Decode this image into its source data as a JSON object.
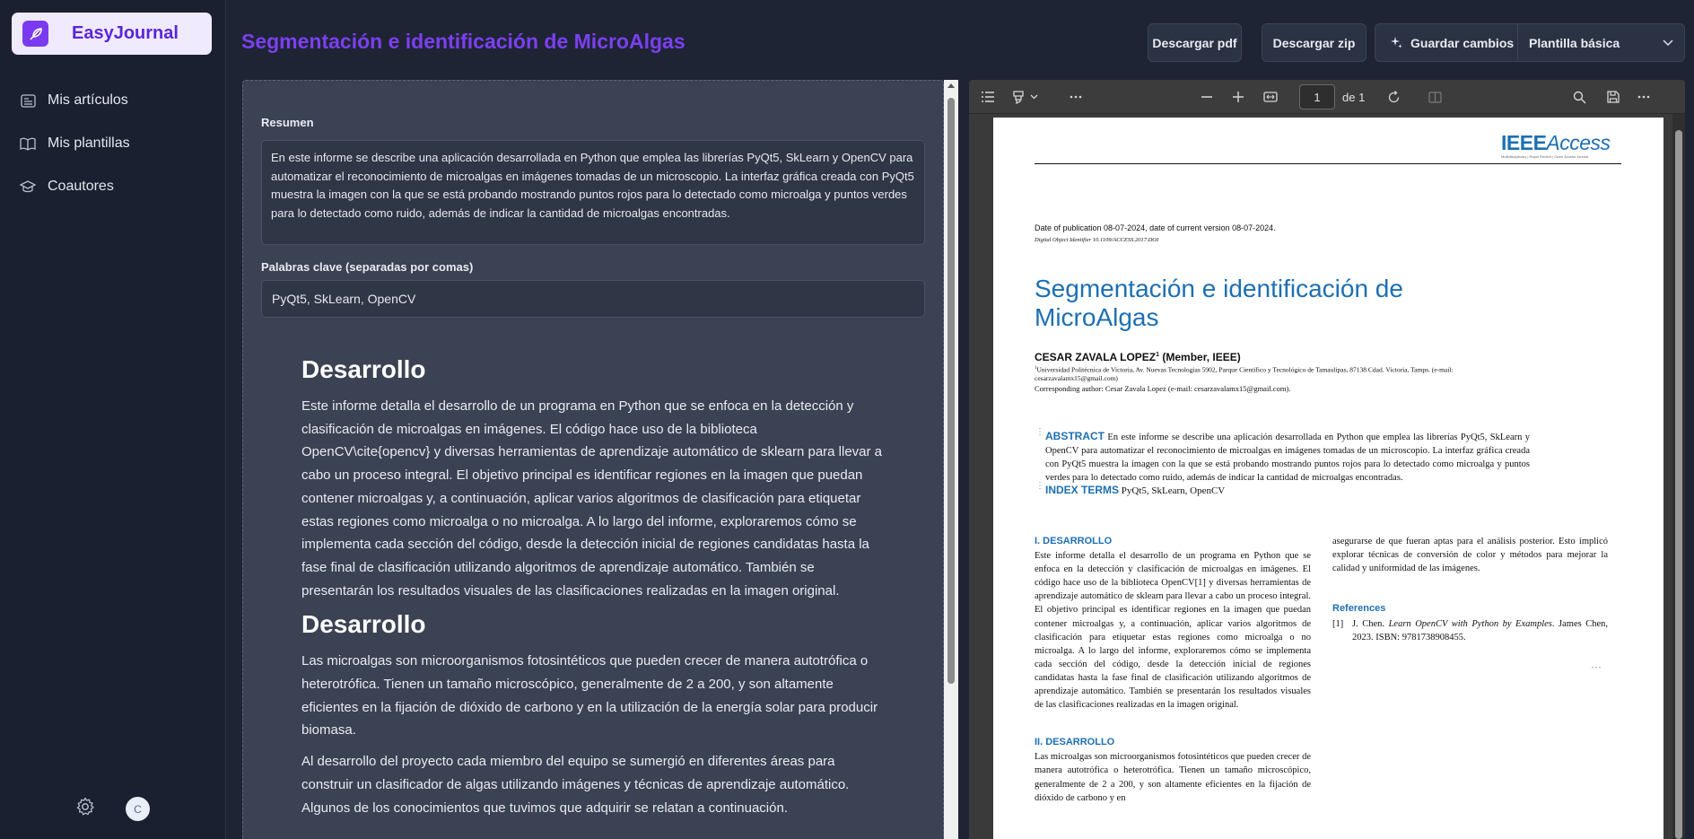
{
  "app": {
    "name": "EasyJournal"
  },
  "nav": [
    {
      "label": "Mis artículos",
      "icon": "articles-icon"
    },
    {
      "label": "Mis plantillas",
      "icon": "book-icon"
    },
    {
      "label": "Coautores",
      "icon": "graduation-cap-icon"
    }
  ],
  "user": {
    "initial": "C"
  },
  "header": {
    "title": "Segmentación e identificación de MicroAlgas",
    "download_pdf": "Descargar pdf",
    "download_zip": "Descargar zip",
    "save": "Guardar cambios",
    "template": "Plantilla básica"
  },
  "editor": {
    "summary_label": "Resumen",
    "summary": "En este informe se describe una aplicación desarrollada en Python que emplea las librerías PyQt5, SkLearn y OpenCV para automatizar el reconocimiento de microalgas en imágenes tomadas de un microscopio. La interfaz gráfica creada con PyQt5 muestra la imagen con la que se está probando mostrando puntos rojos para lo detectado como microalga y puntos verdes para lo detectado como ruido, además de indicar la cantidad de microalgas encontradas.",
    "keywords_label": "Palabras clave (separadas por comas)",
    "keywords": "PyQt5, SkLearn, OpenCV",
    "section1_title": "Desarrollo",
    "section1_p1": "Este informe detalla el desarrollo de un programa en Python que se enfoca en la detección y clasificación de microalgas en imágenes. El código hace uso de la biblioteca OpenCV\\cite{opencv} y diversas herramientas de aprendizaje automático de sklearn para llevar a cabo un proceso integral. El objetivo principal es identificar regiones en la imagen que puedan contener microalgas y, a continuación, aplicar varios algoritmos de clasificación para etiquetar estas regiones como microalga o no microalga. A lo largo del informe, exploraremos cómo se implementa cada sección del código, desde la detección inicial de regiones candidatas hasta la fase final de clasificación utilizando algoritmos de aprendizaje automático. También se presentarán los resultados visuales de las clasificaciones realizadas en la imagen original.",
    "section2_title": "Desarrollo",
    "section2_p1": "Las microalgas son microorganismos fotosintéticos que pueden crecer de manera autotrófica o heterotrófica. Tienen un tamaño microscópico, generalmente de 2 a 200, y son altamente eficientes en la fijación de dióxido de carbono y en la utilización de la energía solar para producir biomasa.",
    "section2_p2": "Al desarrollo del proyecto cada miembro del equipo se sumergió en diferentes áreas para construir un clasificador de algas utilizando imágenes y técnicas de aprendizaje automático. Algunos de los conocimientos que tuvimos que adquirir se relatan a continuación."
  },
  "pdf": {
    "page_current": "1",
    "page_of": "de 1",
    "logo_main": "IEEE",
    "logo_access": "Access",
    "logo_tagline": "Multidisciplinary | Rapid Review | Open Access Journal",
    "pubdate": "Date of publication 08-07-2024, date of current version 08-07-2024.",
    "doi": "Digital Object Identifier 10.1109/ACCESS.2017.DOI",
    "title": "Segmentación e identificación de MicroAlgas",
    "author": "CESAR ZAVALA LOPEZ",
    "author_sup": "1",
    "author_role": " (Member, IEEE)",
    "affil": "Universidad Politécnica de Victoria, Av. Nuevas Tecnologías 5902, Parque Científico y Tecnológico de Tamaulipas, 87138 Cdad. Victoria, Tamps. (e-mail: cesarzavalamx15@gmail.com)",
    "corresponding": "Corresponding author: Cesar Zavala Lopez (e-mail: cesarzavalamx15@gmail.com).",
    "abstract_key": "ABSTRACT",
    "abstract": "En este informe se describe una aplicación desarrollada en Python que emplea las librerías PyQt5, SkLearn y OpenCV para automatizar el reconocimiento de microalgas en imágenes tomadas de un microscopio. La interfaz gráfica creada con PyQt5 muestra la imagen con la que se está probando mostrando puntos rojos para lo detectado como microalga y puntos verdes para lo detectado como ruido, además de indicar la cantidad de microalgas encontradas.",
    "index_key": "INDEX TERMS",
    "index_terms": "PyQt5, SkLearn, OpenCV",
    "sec1_title": "I. DESARROLLO",
    "sec1_text": "Este informe detalla el desarrollo de un programa en Python que se enfoca en la detección y clasificación de microalgas en imágenes. El código hace uso de la biblioteca OpenCV[1] y diversas herramientas de aprendizaje automático de sklearn para llevar a cabo un proceso integral. El objetivo principal es identificar regiones en la imagen que puedan contener microalgas y, a continuación, aplicar varios algoritmos de clasificación para etiquetar estas regiones como microalga o no microalga. A lo largo del informe, exploraremos cómo se implementa cada sección del código, desde la detección inicial de regiones candidatas hasta la fase final de clasificación utilizando algoritmos de aprendizaje automático. También se presentarán los resultados visuales de las clasificaciones realizadas en la imagen original.",
    "sec2_title": "II. DESARROLLO",
    "sec2_text": "Las microalgas son microorganismos fotosintéticos que pueden crecer de manera autotrófica o heterotrófica. Tienen un tamaño microscópico, generalmente de 2 a 200, y son altamente eficientes en la fijación de dióxido de carbono y en",
    "col2_text": "asegurarse de que fueran aptas para el análisis posterior. Esto implicó explorar técnicas de conversión de color y métodos para mejorar la calidad y uniformidad de las imágenes.",
    "refs_title": "References",
    "ref1_num": "[1]",
    "ref1_author": "J. Chen. ",
    "ref1_title": "Learn OpenCV with Python by Examples",
    "ref1_rest": ". James Chen, 2023. ISBN: 9781738908455."
  },
  "colors": {
    "accent": "#7b3ff2",
    "ieee_blue": "#1d6fb3",
    "bg": "#1e2433"
  }
}
